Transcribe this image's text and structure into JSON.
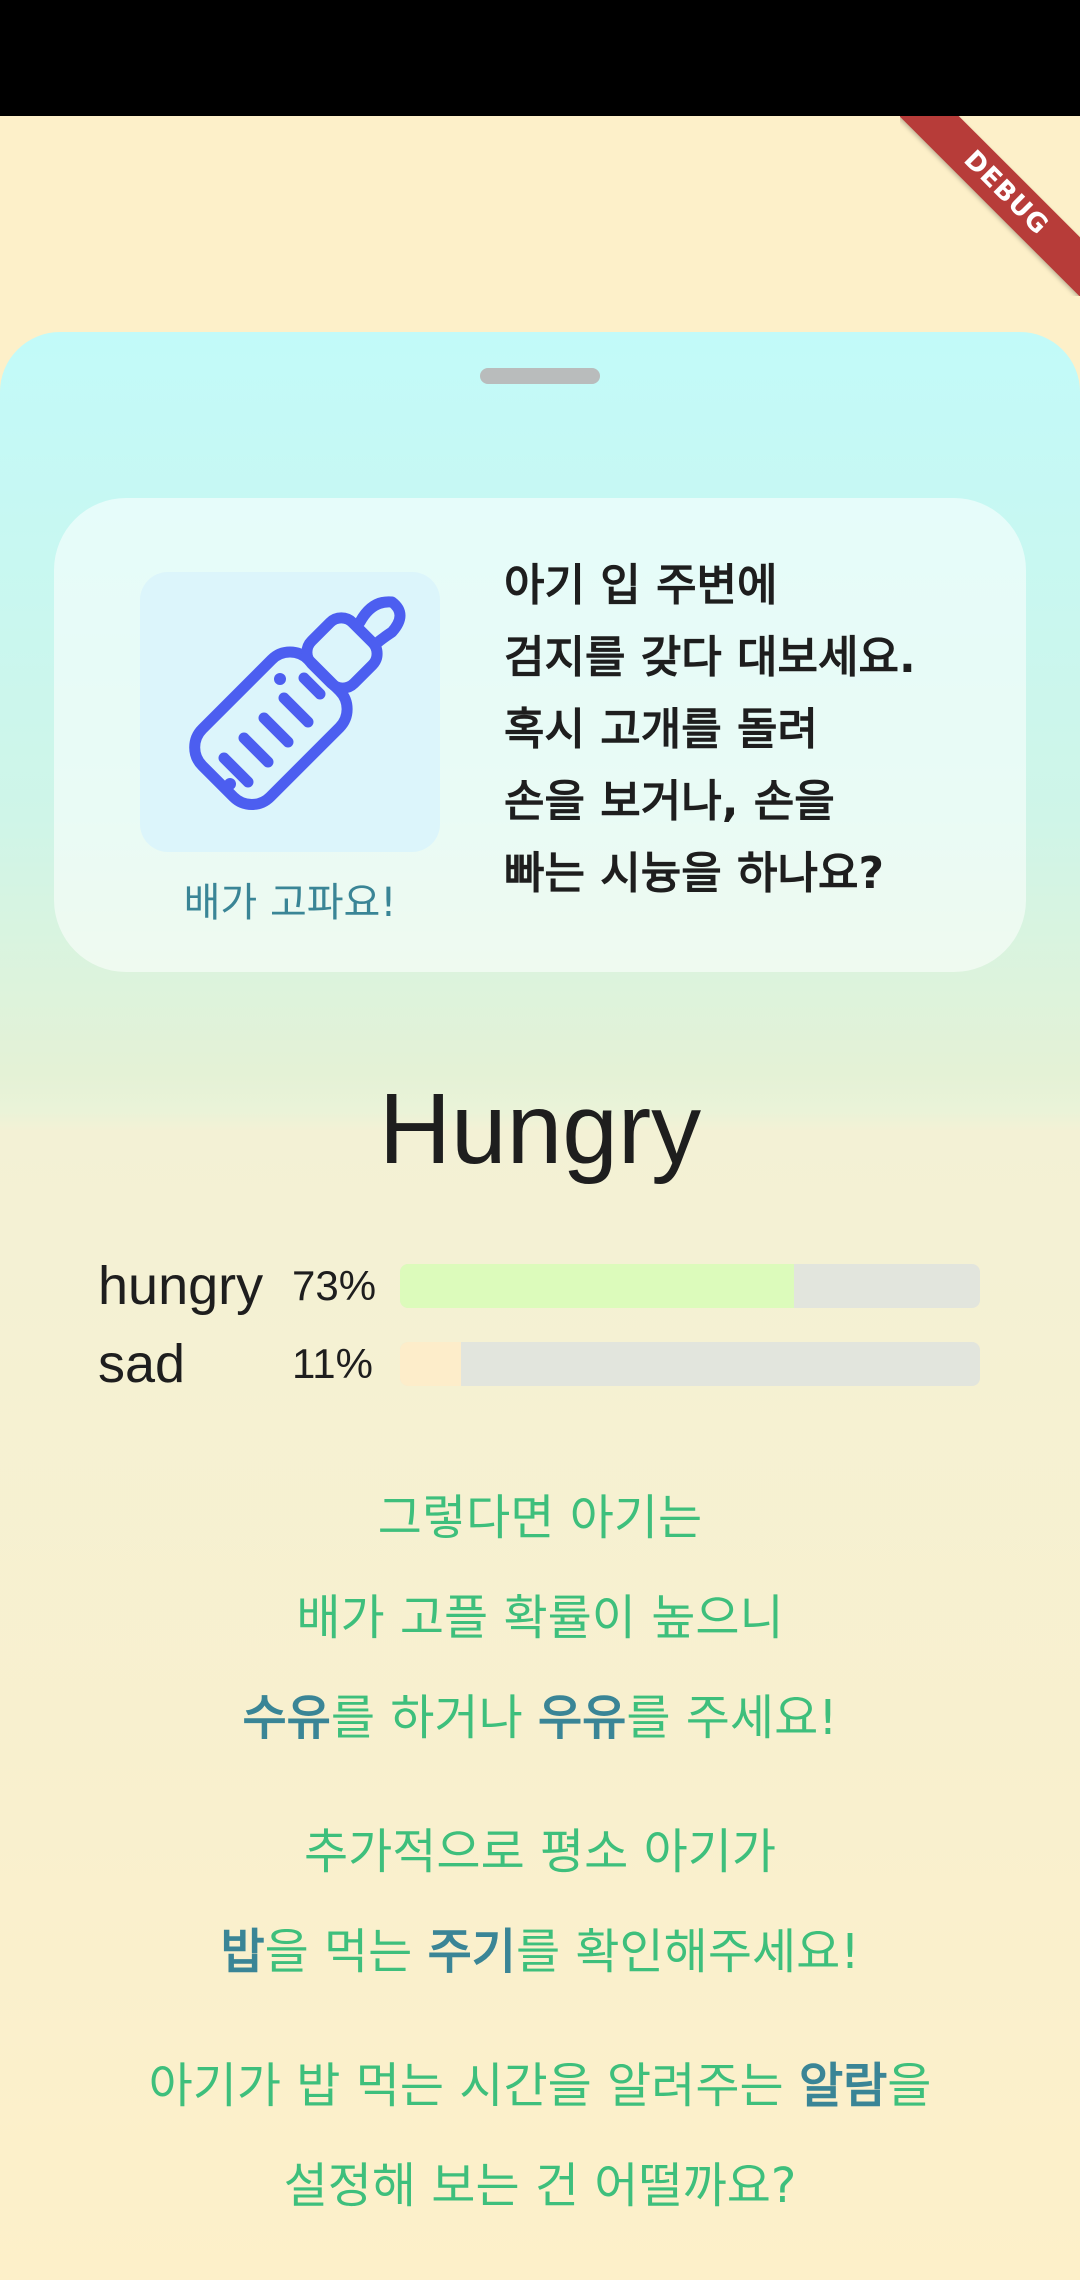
{
  "debug_banner": {
    "label": "DEBUG",
    "color": "#b73c39"
  },
  "card": {
    "icon": "baby-bottle-icon",
    "icon_color": "#4c5ef0",
    "caption": "배가 고파요!",
    "instruction_lines": [
      "아기 입 주변에",
      "검지를 갖다 대보세요.",
      "혹시 고개를 돌려",
      "손을 보거나, 손을",
      "빠는 시늉을 하나요?"
    ]
  },
  "result": {
    "title": "Hungry",
    "probabilities": [
      {
        "label": "hungry",
        "value_text": "73%",
        "fraction": 0.68,
        "color": "#dcfbbb"
      },
      {
        "label": "sad",
        "value_text": "11%",
        "fraction": 0.105,
        "color": "#fdedca"
      }
    ]
  },
  "advice": {
    "line1": "그렇다면 아기는",
    "line2": "배가 고플 확률이 높으니",
    "line3": {
      "k1": "수유",
      "t1": "를 하거나 ",
      "k2": "우유",
      "t2": "를 주세요!"
    },
    "line4": "추가적으로 평소 아기가",
    "line5": {
      "k1": "밥",
      "t1": "을 먹는 ",
      "k2": "주기",
      "t2": "를 확인해주세요!"
    },
    "line6": {
      "t1": "아기가 밥 먹는 시간을 알려주는 ",
      "k1": "알람",
      "t2": "을"
    },
    "line7": "설정해 보는 건 어떨까요?",
    "accent_color": "#3ebf7c",
    "keyword_color": "#3a8596"
  }
}
